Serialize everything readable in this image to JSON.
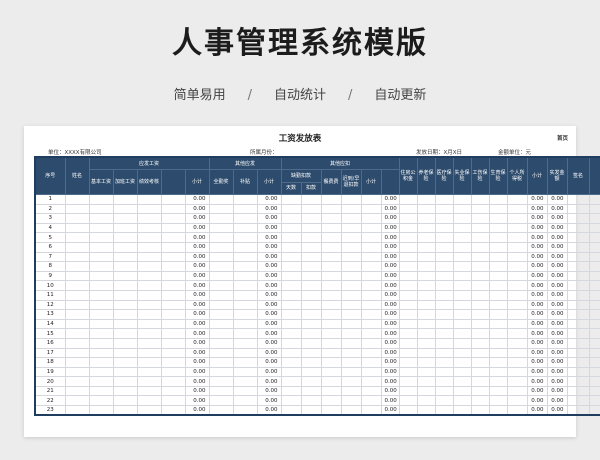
{
  "hero": {
    "title": "人事管理系统模版",
    "features": [
      "简单易用",
      "自动统计",
      "自动更新"
    ],
    "separator": "/"
  },
  "sheet": {
    "title": "工资发放表",
    "corner_link": "首页",
    "unit_label": "单位：XXXX有限公司",
    "month_label": "所属月份：",
    "date_label": "发放日期：X月X日",
    "money_label": "金额单位：元"
  },
  "table": {
    "header": {
      "seq": "序号",
      "name": "姓名",
      "pay_group": "应发工资",
      "base": "基本工资",
      "overtime": "加班工资",
      "performance": "绩效考核",
      "subtotal1": "小计",
      "other_pay_group": "其他应发",
      "attendance_bonus": "全勤奖",
      "allowance": "补贴",
      "subtotal2": "小计",
      "other_deduct_group": "其他应扣",
      "absence_group": "缺勤扣款",
      "days": "天数",
      "absence_deduct": "扣款",
      "meal": "餐费费",
      "late_leave": "迟到/早退扣款",
      "subtotal3": "小计",
      "housing_fund": "住房公积金",
      "pension": "养老保险",
      "medical": "医疗保险",
      "unemployment": "失业保险",
      "injury": "工伤保险",
      "maternity": "生育保险",
      "income_tax": "个人所得税",
      "subtotal4": "小计",
      "net_pay": "实发金额",
      "signature": "签名"
    },
    "rows": [
      {
        "n": "1",
        "s1": "0.00",
        "s2": "0.00",
        "s3": "0.00",
        "s4": "0.00",
        "net": "0.00"
      },
      {
        "n": "2",
        "s1": "0.00",
        "s2": "0.00",
        "s3": "0.00",
        "s4": "0.00",
        "net": "0.00"
      },
      {
        "n": "3",
        "s1": "0.00",
        "s2": "0.00",
        "s3": "0.00",
        "s4": "0.00",
        "net": "0.00"
      },
      {
        "n": "4",
        "s1": "0.00",
        "s2": "0.00",
        "s3": "0.00",
        "s4": "0.00",
        "net": "0.00"
      },
      {
        "n": "5",
        "s1": "0.00",
        "s2": "0.00",
        "s3": "0.00",
        "s4": "0.00",
        "net": "0.00"
      },
      {
        "n": "6",
        "s1": "0.00",
        "s2": "0.00",
        "s3": "0.00",
        "s4": "0.00",
        "net": "0.00"
      },
      {
        "n": "7",
        "s1": "0.00",
        "s2": "0.00",
        "s3": "0.00",
        "s4": "0.00",
        "net": "0.00"
      },
      {
        "n": "8",
        "s1": "0.00",
        "s2": "0.00",
        "s3": "0.00",
        "s4": "0.00",
        "net": "0.00"
      },
      {
        "n": "9",
        "s1": "0.00",
        "s2": "0.00",
        "s3": "0.00",
        "s4": "0.00",
        "net": "0.00"
      },
      {
        "n": "10",
        "s1": "0.00",
        "s2": "0.00",
        "s3": "0.00",
        "s4": "0.00",
        "net": "0.00"
      },
      {
        "n": "11",
        "s1": "0.00",
        "s2": "0.00",
        "s3": "0.00",
        "s4": "0.00",
        "net": "0.00"
      },
      {
        "n": "12",
        "s1": "0.00",
        "s2": "0.00",
        "s3": "0.00",
        "s4": "0.00",
        "net": "0.00"
      },
      {
        "n": "13",
        "s1": "0.00",
        "s2": "0.00",
        "s3": "0.00",
        "s4": "0.00",
        "net": "0.00"
      },
      {
        "n": "14",
        "s1": "0.00",
        "s2": "0.00",
        "s3": "0.00",
        "s4": "0.00",
        "net": "0.00"
      },
      {
        "n": "15",
        "s1": "0.00",
        "s2": "0.00",
        "s3": "0.00",
        "s4": "0.00",
        "net": "0.00"
      },
      {
        "n": "16",
        "s1": "0.00",
        "s2": "0.00",
        "s3": "0.00",
        "s4": "0.00",
        "net": "0.00"
      },
      {
        "n": "17",
        "s1": "0.00",
        "s2": "0.00",
        "s3": "0.00",
        "s4": "0.00",
        "net": "0.00"
      },
      {
        "n": "18",
        "s1": "0.00",
        "s2": "0.00",
        "s3": "0.00",
        "s4": "0.00",
        "net": "0.00"
      },
      {
        "n": "19",
        "s1": "0.00",
        "s2": "0.00",
        "s3": "0.00",
        "s4": "0.00",
        "net": "0.00"
      },
      {
        "n": "20",
        "s1": "0.00",
        "s2": "0.00",
        "s3": "0.00",
        "s4": "0.00",
        "net": "0.00"
      },
      {
        "n": "21",
        "s1": "0.00",
        "s2": "0.00",
        "s3": "0.00",
        "s4": "0.00",
        "net": "0.00"
      },
      {
        "n": "22",
        "s1": "0.00",
        "s2": "0.00",
        "s3": "0.00",
        "s4": "0.00",
        "net": "0.00"
      },
      {
        "n": "23",
        "s1": "0.00",
        "s2": "0.00",
        "s3": "0.00",
        "s4": "0.00",
        "net": "0.00"
      }
    ]
  },
  "colors": {
    "header_bg": "#2d4b6c",
    "grid_border": "#1f3d5f"
  }
}
